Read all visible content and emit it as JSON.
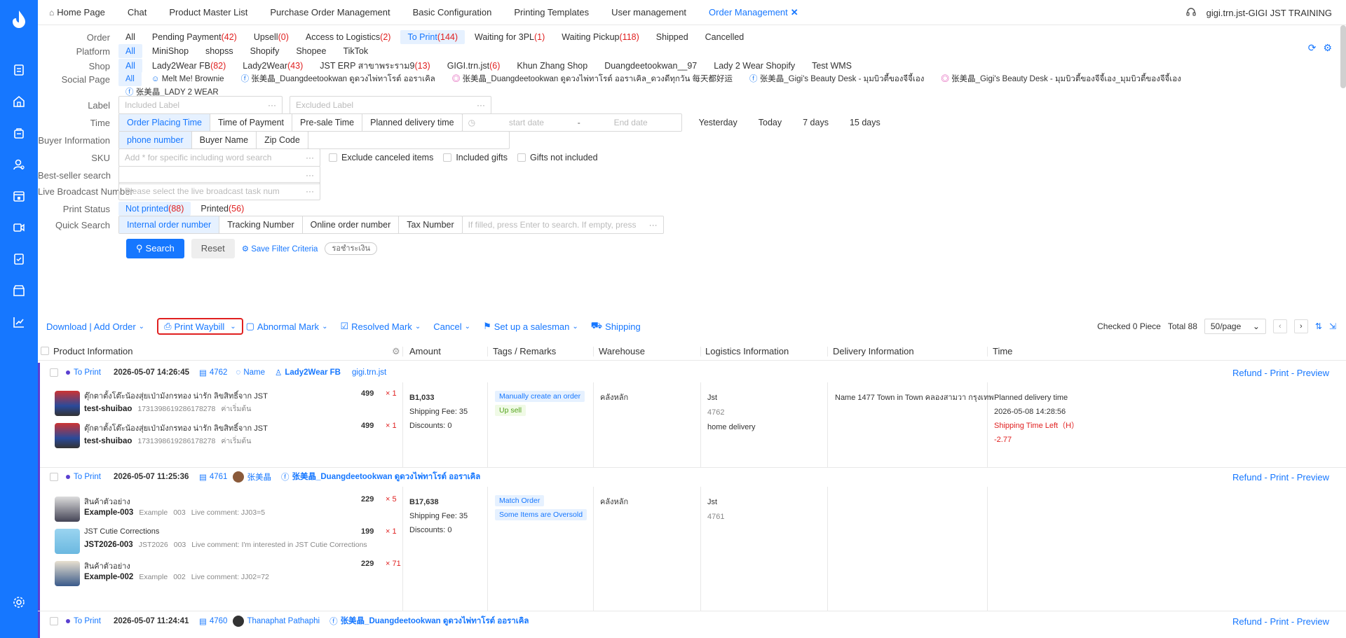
{
  "sidebar": {
    "icons": [
      "logo-icon",
      "orders-icon",
      "home-icon",
      "bag-icon",
      "user-settings-icon",
      "store-icon",
      "video-icon",
      "report-icon",
      "shop-icon",
      "chart-icon",
      "gear-icon"
    ]
  },
  "tabs": [
    {
      "label": "Home Page",
      "icon": "home-icon"
    },
    {
      "label": "Chat"
    },
    {
      "label": "Product Master List"
    },
    {
      "label": "Purchase Order Management"
    },
    {
      "label": "Basic Configuration"
    },
    {
      "label": "Printing Templates"
    },
    {
      "label": "User management"
    },
    {
      "label": "Order Management",
      "active": true
    }
  ],
  "user": "gigi.trn.jst-GIGI JST TRAINING",
  "filters": {
    "order": {
      "label": "Order",
      "options": [
        {
          "text": "All",
          "count": ""
        },
        {
          "text": "Pending Payment",
          "count": "(42)"
        },
        {
          "text": "Upsell",
          "count": "(0)"
        },
        {
          "text": "Access to Logistics",
          "count": "(2)"
        },
        {
          "text": "To Print",
          "count": "(144)",
          "sel": true
        },
        {
          "text": "Waiting for 3PL",
          "count": "(1)"
        },
        {
          "text": "Waiting Pickup",
          "count": "(118)"
        },
        {
          "text": "Shipped",
          "count": ""
        },
        {
          "text": "Cancelled",
          "count": ""
        }
      ]
    },
    "platform": {
      "label": "Platform",
      "options": [
        "All",
        "MiniShop",
        "shopss",
        "Shopify",
        "Shopee",
        "TikTok"
      ]
    },
    "shop": {
      "label": "Shop",
      "options": [
        {
          "text": "All",
          "count": ""
        },
        {
          "text": "Lady2Wear FB",
          "count": "(82)"
        },
        {
          "text": "Lady2Wear",
          "count": "(43)"
        },
        {
          "text": "JST ERP สาขาพระราม9",
          "count": "(13)"
        },
        {
          "text": "GIGI.trn.jst",
          "count": "(6)"
        },
        {
          "text": "Khun Zhang Shop",
          "count": ""
        },
        {
          "text": "Duangdeetookwan__97",
          "count": ""
        },
        {
          "text": "Lady 2 Wear Shopify",
          "count": ""
        },
        {
          "text": "Test WMS",
          "count": ""
        }
      ]
    },
    "social": {
      "label": "Social Page",
      "options": [
        "All",
        "Melt Me! Brownie",
        "张美晶_Duangdeetookwan ดูดวงไพ่ทาโรต์ ออราเคิล",
        "张美晶_Duangdeetookwan ดูดวงไพ่ทาโรต์ ออราเคิล_ดวงดีทุกวัน 每天都好运",
        "张美晶_Gigi's Beauty Desk - มุมบิวตี้ของจีจี้เอง",
        "张美晶_Gigi's Beauty Desk - มุมบิวตี้ของจีจี้เอง_มุมบิวตี้ของจีจี้เอง",
        "张美晶_LADY 2 WEAR"
      ]
    },
    "label": {
      "label": "Label",
      "included": "Included Label",
      "excluded": "Excluded Label"
    },
    "time": {
      "label": "Time",
      "options": [
        "Order Placing Time",
        "Time of Payment",
        "Pre-sale Time",
        "Planned delivery time"
      ],
      "start": "start date",
      "sep": "-",
      "end": "End date",
      "quick": [
        "Yesterday",
        "Today",
        "7 days",
        "15 days"
      ]
    },
    "buyer": {
      "label": "Buyer Information",
      "options": [
        "phone number",
        "Buyer Name",
        "Zip Code"
      ]
    },
    "sku": {
      "label": "SKU",
      "placeholder": "Add * for specific including word search",
      "checks": [
        "Exclude canceled items",
        "Included gifts",
        "Gifts not included"
      ]
    },
    "bestseller": {
      "label": "Best-seller search"
    },
    "live": {
      "label": "Live Broadcast Number",
      "placeholder": "Please select the live broadcast task num"
    },
    "print": {
      "label": "Print Status",
      "options": [
        {
          "text": "Not printed",
          "count": "(88)"
        },
        {
          "text": "Printed",
          "count": "(56)"
        }
      ]
    },
    "quick": {
      "label": "Quick Search",
      "options": [
        "Internal order number",
        "Tracking Number",
        "Online order number",
        "Tax Number"
      ],
      "placeholder": "If filled, press Enter to search. If empty, press"
    },
    "search": "Search",
    "reset": "Reset",
    "save": "Save Filter Criteria",
    "pill": "รอชำระเงิน"
  },
  "toolbar": {
    "download": "Download | Add Order",
    "print": "Print Waybill",
    "abnormal": "Abnormal Mark",
    "resolved": "Resolved Mark",
    "cancel": "Cancel",
    "salesman": "Set up a salesman",
    "shipping": "Shipping",
    "checked": "Checked 0 Piece",
    "total": "Total 88",
    "pagesize": "50/page"
  },
  "columns": [
    "Product Information",
    "Amount",
    "Tags / Remarks",
    "Warehouse",
    "Logistics Information",
    "Delivery Information",
    "Time"
  ],
  "orders": [
    {
      "status": "To Print",
      "datetime": "2026-05-07 14:26:45",
      "id": "4762",
      "buyer": "Name",
      "shop": "Lady2Wear FB",
      "shop2": "gigi.trn.jst",
      "actions": "Refund - Print - Preview",
      "items": [
        {
          "name": "ตุ๊กตาตั้งโต๊ะน้องสุ่ยเป่ามังกรทอง น่ารัก ลิขสิทธิ์จาก JST",
          "sku": "test-shuibao",
          "code": "1731398619286178278",
          "note": "ค่าเริ่มต้น",
          "price": "499",
          "qty": "× 1"
        },
        {
          "name": "ตุ๊กตาตั้งโต๊ะน้องสุ่ยเป่ามังกรทอง น่ารัก ลิขสิทธิ์จาก JST",
          "sku": "test-shuibao",
          "code": "1731398619286178278",
          "note": "ค่าเริ่มต้น",
          "price": "499",
          "qty": "× 1"
        }
      ],
      "amount": "B1,033",
      "fee": "Shipping Fee:  35",
      "discount": "Discounts:  0",
      "tags": [
        "Manually create an order",
        "Up sell"
      ],
      "warehouse": "คลังหลัก",
      "logistics": [
        "Jst",
        "4762",
        "home delivery"
      ],
      "delivery": "Name 1477 Town in Town คลองสามวา กรุงเทพ",
      "time": [
        "Planned delivery time",
        "2026-05-08 14:28:56",
        "Shipping Time Left（H）",
        "-2.77"
      ]
    },
    {
      "status": "To Print",
      "datetime": "2026-05-07 11:25:36",
      "id": "4761",
      "buyer": "张美晶",
      "shop": "张美晶_Duangdeetookwan ดูดวงไพ่ทาโรต์ ออราเคิล",
      "actions": "Refund - Print - Preview",
      "items": [
        {
          "name": "สินค้าตัวอย่าง",
          "sku": "Example-003",
          "code": "Example",
          "code2": "003",
          "note": "Live comment:  JJ03=5",
          "price": "229",
          "qty": "× 5"
        },
        {
          "name": "JST Cutie Corrections",
          "sku": "JST2026-003",
          "code": "JST2026",
          "code2": "003",
          "note": "Live comment:  I'm interested in JST Cutie Corrections",
          "price": "199",
          "qty": "× 1"
        },
        {
          "name": "สินค้าตัวอย่าง",
          "sku": "Example-002",
          "code": "Example",
          "code2": "002",
          "note": "Live comment:  JJ02=72",
          "price": "229",
          "qty": "× 71"
        }
      ],
      "amount": "B17,638",
      "fee": "Shipping Fee:  35",
      "discount": "Discounts:  0",
      "tags": [
        "Match Order",
        "Some Items are Oversold"
      ],
      "warehouse": "คลังหลัก",
      "logistics": [
        "Jst",
        "4761"
      ]
    },
    {
      "status": "To Print",
      "datetime": "2026-05-07 11:24:41",
      "id": "4760",
      "buyer": "Thanaphat Pathaphi",
      "shop": "张美晶_Duangdeetookwan ดูดวงไพ่ทาโรต์ ออราเคิล",
      "actions": "Refund - Print - Preview"
    }
  ]
}
